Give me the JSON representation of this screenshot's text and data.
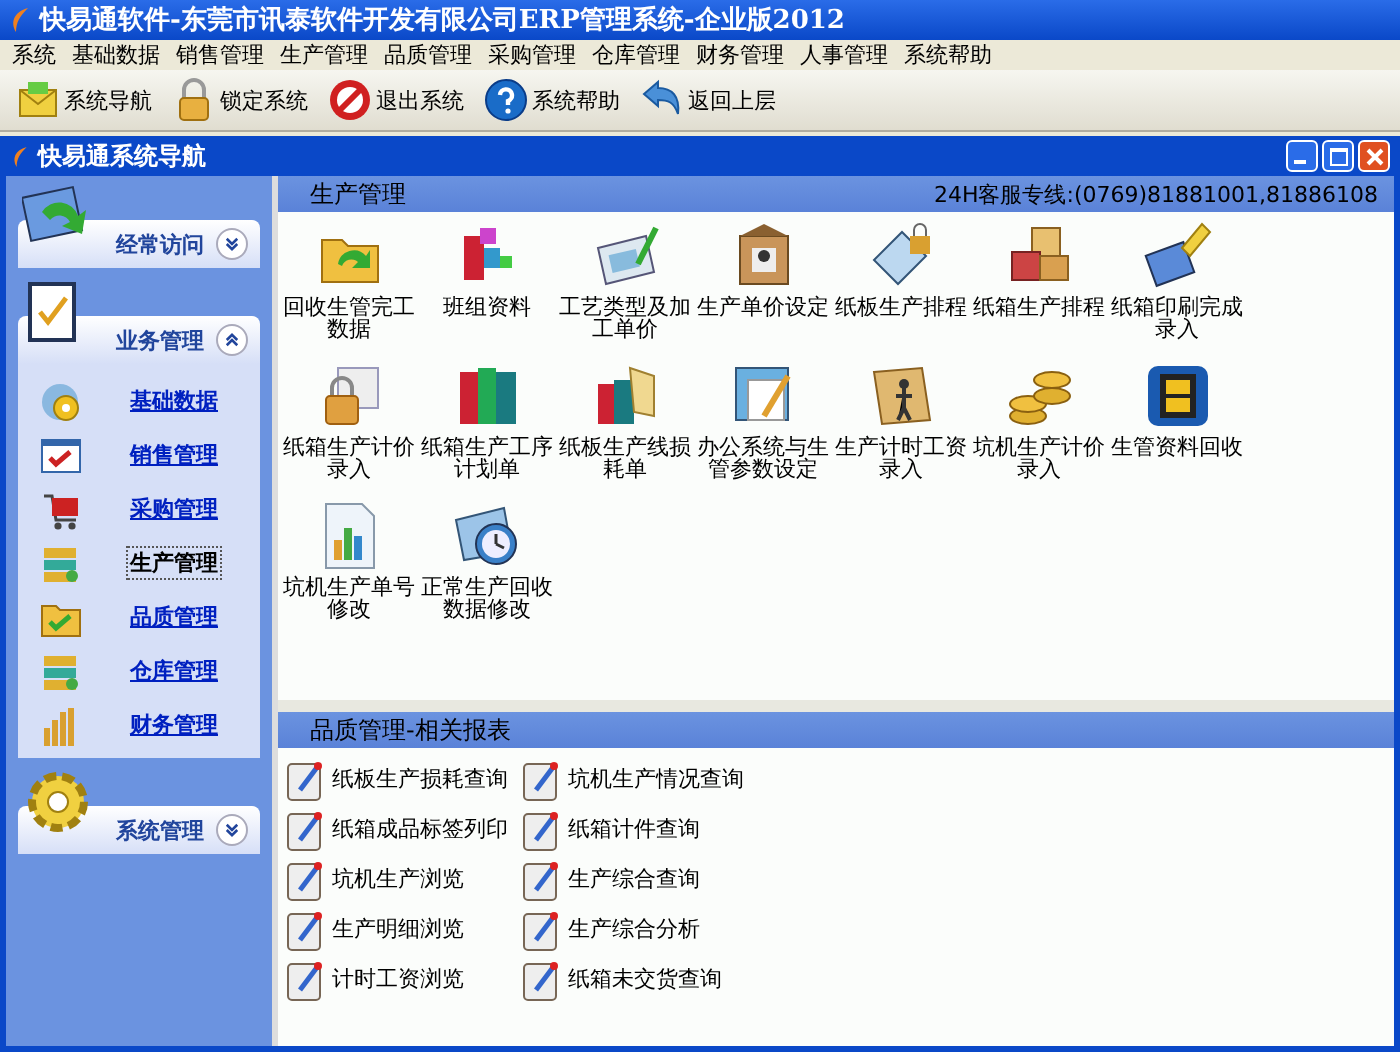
{
  "window": {
    "title": "快易通软件-东莞市讯泰软件开发有限公司ERP管理系统-企业版2012"
  },
  "menu": [
    "系统",
    "基础数据",
    "销售管理",
    "生产管理",
    "品质管理",
    "采购管理",
    "仓库管理",
    "财务管理",
    "人事管理",
    "系统帮助"
  ],
  "toolbar": [
    {
      "label": "系统导航",
      "kind": "nav"
    },
    {
      "label": "锁定系统",
      "kind": "lock"
    },
    {
      "label": "退出系统",
      "kind": "exit"
    },
    {
      "label": "系统帮助",
      "kind": "help"
    },
    {
      "label": "返回上层",
      "kind": "back"
    }
  ],
  "nav_window": {
    "title": "快易通系统导航"
  },
  "sidebar": {
    "groups": [
      {
        "title": "经常访问",
        "expanded": false
      },
      {
        "title": "业务管理",
        "expanded": true,
        "items": [
          {
            "label": "基础数据",
            "selected": false
          },
          {
            "label": "销售管理",
            "selected": false
          },
          {
            "label": "采购管理",
            "selected": false
          },
          {
            "label": "生产管理",
            "selected": true
          },
          {
            "label": "品质管理",
            "selected": false
          },
          {
            "label": "仓库管理",
            "selected": false
          },
          {
            "label": "财务管理",
            "selected": false
          }
        ]
      },
      {
        "title": "系统管理",
        "expanded": false
      }
    ]
  },
  "module_panel": {
    "title": "生产管理",
    "hotline": "24H客服专线:(0769)81881001,81886108",
    "items": [
      "回收生管完工数据",
      "班组资料",
      "工艺类型及加工单价",
      "生产单价设定",
      "纸板生产排程",
      "纸箱生产排程",
      "纸箱印刷完成录入",
      "纸箱生产计价录入",
      "纸箱生产工序计划单",
      "纸板生产线损耗单",
      "办公系统与生管参数设定",
      "生产计时工资录入",
      "坑机生产计价录入",
      "生管资料回收",
      "坑机生产单号修改",
      "正常生产回收数据修改"
    ]
  },
  "report_panel": {
    "title": "品质管理-相关报表",
    "items": [
      "纸板生产损耗查询",
      "坑机生产情况查询",
      "纸箱成品标签列印",
      "纸箱计件查询",
      "坑机生产浏览",
      "生产综合查询",
      "生产明细浏览",
      "生产综合分析",
      "计时工资浏览",
      "纸箱未交货查询"
    ]
  }
}
